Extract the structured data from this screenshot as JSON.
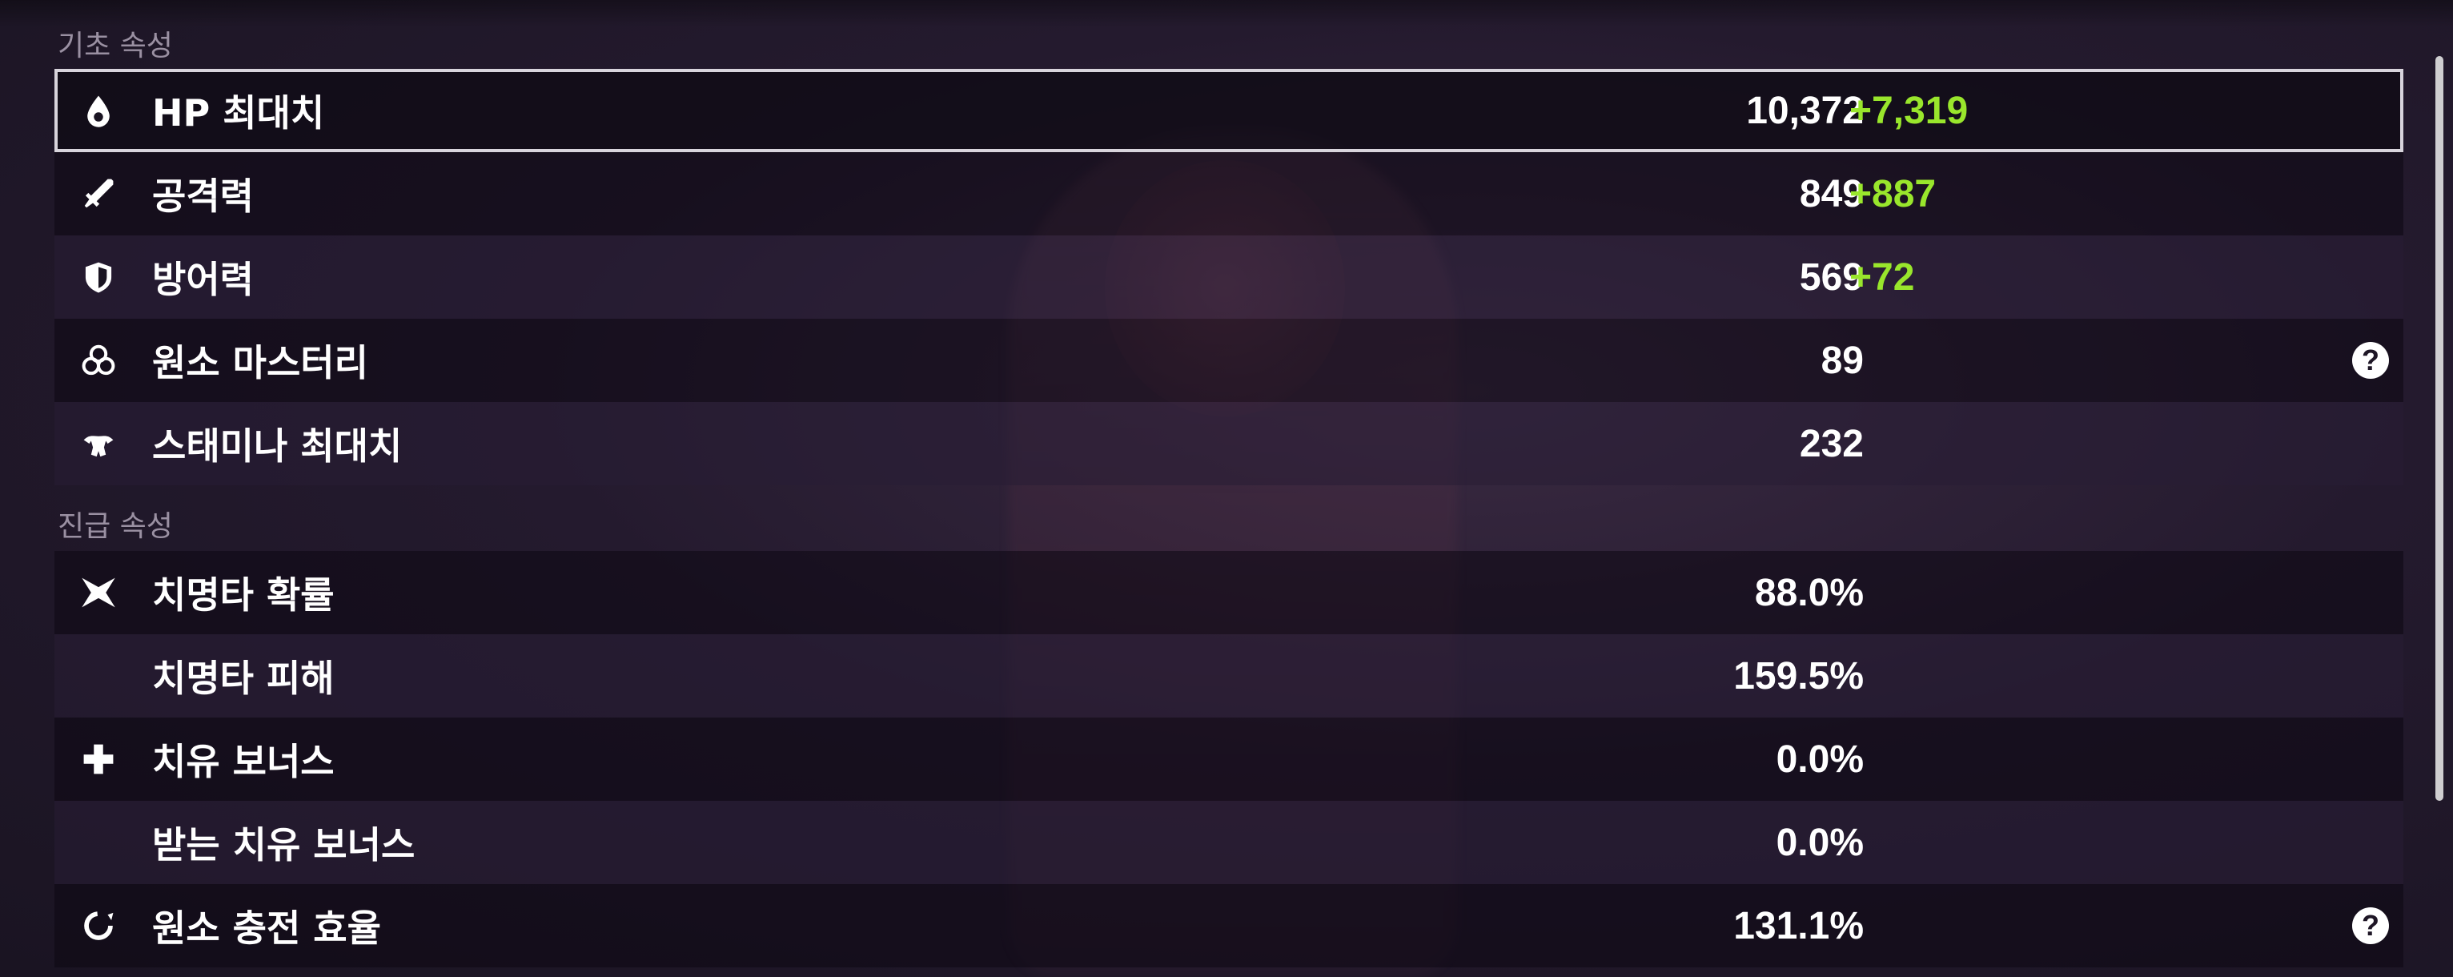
{
  "sections": {
    "base": {
      "title": "기초 속성"
    },
    "advanced": {
      "title": "진급 속성"
    }
  },
  "base_stats": [
    {
      "icon": "water-drop-icon",
      "label": "HP 최대치",
      "value": "10,372",
      "bonus": "+7,319",
      "selected": true
    },
    {
      "icon": "sword-icon",
      "label": "공격력",
      "value": "849",
      "bonus": "+887"
    },
    {
      "icon": "shield-icon",
      "label": "방어력",
      "value": "569",
      "bonus": "+72"
    },
    {
      "icon": "elemental-mastery-icon",
      "label": "원소 마스터리",
      "value": "89",
      "bonus": "",
      "help": true
    },
    {
      "icon": "stamina-icon",
      "label": "스태미나 최대치",
      "value": "232",
      "bonus": ""
    }
  ],
  "advanced_stats": [
    {
      "icon": "crit-star-icon",
      "label": "치명타 확률",
      "value": "88.0%"
    },
    {
      "icon": "",
      "label": "치명타 피해",
      "value": "159.5%"
    },
    {
      "icon": "healing-cross-icon",
      "label": "치유 보너스",
      "value": "0.0%"
    },
    {
      "icon": "",
      "label": "받는 치유 보너스",
      "value": "0.0%"
    },
    {
      "icon": "energy-recharge-icon",
      "label": "원소 충전 효율",
      "value": "131.1%",
      "help": true
    }
  ],
  "help": {
    "glyph": "?"
  },
  "colors": {
    "bonus": "#99e62c",
    "heading": "#9a90a2",
    "selected_border": "#d8d4dc"
  }
}
